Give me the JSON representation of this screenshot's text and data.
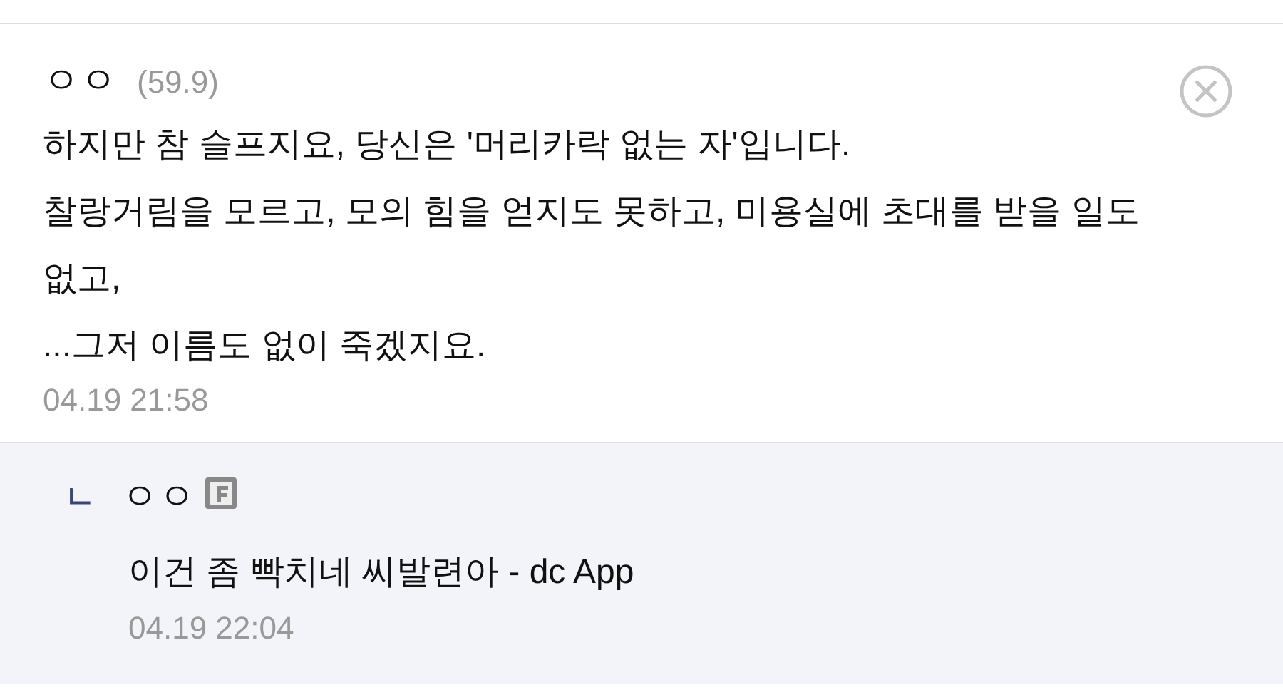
{
  "comment": {
    "author": "ㅇㅇ",
    "ip": "(59.9)",
    "body": "하지만 참 슬프지요, 당신은 '머리카락 없는 자'입니다.\n찰랑거림을 모르고, 모의 힘을 얻지도 못하고, 미용실에 초대를 받을 일도 없고,\n...그저 이름도 없이 죽겠지요.",
    "time": "04.19 21:58"
  },
  "reply": {
    "marker": "ㄴ",
    "author": "ㅇㅇ",
    "text": "이건 좀 빡치네 씨발련아 - dc App",
    "time": "04.19 22:04"
  }
}
